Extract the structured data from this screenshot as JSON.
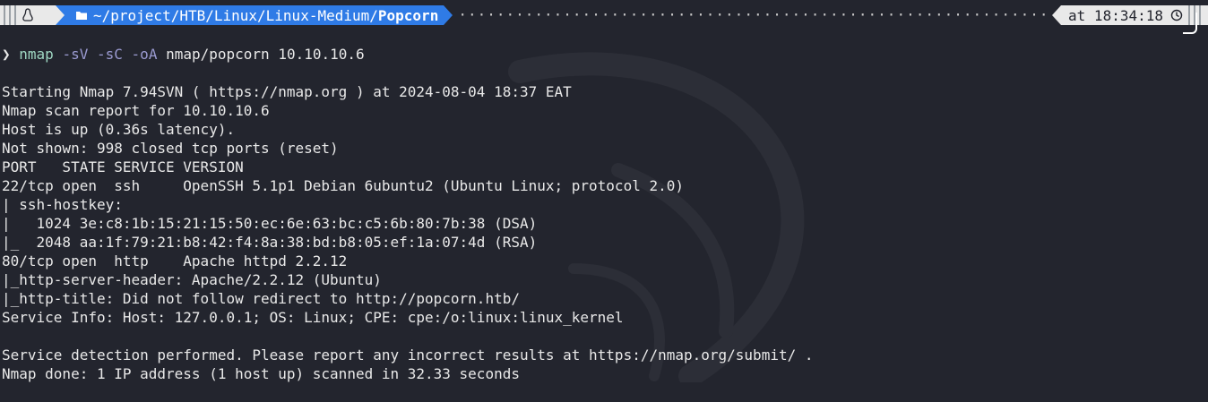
{
  "prompt": {
    "os_icon": "linux-penguin",
    "folder_icon": "folder-icon",
    "path_prefix": "~/project/HTB/Linux/Linux-Medium/",
    "path_current": "Popcorn",
    "time_label": "at 18:34:18",
    "clock_icon": "clock-icon"
  },
  "command": {
    "caret": "❯",
    "program": "nmap",
    "flag1": "-sV",
    "flag2": "-sC",
    "flag3": "-oA",
    "args": "nmap/popcorn 10.10.10.6"
  },
  "output_lines": [
    "Starting Nmap 7.94SVN ( https://nmap.org ) at 2024-08-04 18:37 EAT",
    "Nmap scan report for 10.10.10.6",
    "Host is up (0.36s latency).",
    "Not shown: 998 closed tcp ports (reset)",
    "PORT   STATE SERVICE VERSION",
    "22/tcp open  ssh     OpenSSH 5.1p1 Debian 6ubuntu2 (Ubuntu Linux; protocol 2.0)",
    "| ssh-hostkey: ",
    "|   1024 3e:c8:1b:15:21:15:50:ec:6e:63:bc:c5:6b:80:7b:38 (DSA)",
    "|_  2048 aa:1f:79:21:b8:42:f4:8a:38:bd:b8:05:ef:1a:07:4d (RSA)",
    "80/tcp open  http    Apache httpd 2.2.12",
    "|_http-server-header: Apache/2.2.12 (Ubuntu)",
    "|_http-title: Did not follow redirect to http://popcorn.htb/",
    "Service Info: Host: 127.0.0.1; OS: Linux; CPE: cpe:/o:linux:linux_kernel",
    "",
    "Service detection performed. Please report any incorrect results at https://nmap.org/submit/ .",
    "Nmap done: 1 IP address (1 host up) scanned in 32.33 seconds"
  ],
  "colors": {
    "background": "#23252e",
    "path_segment": "#2f7be6",
    "command": "#9fd7c2",
    "flags": "#9a9ad0"
  }
}
